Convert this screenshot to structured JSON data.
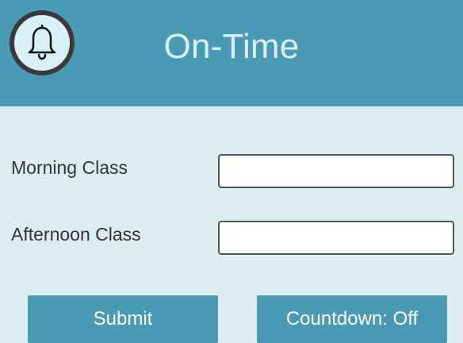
{
  "header": {
    "title": "On-Time",
    "logo_icon": "bell-icon"
  },
  "form": {
    "morning": {
      "label": "Morning Class",
      "value": "",
      "placeholder": ""
    },
    "afternoon": {
      "label": "Afternoon Class",
      "value": "",
      "placeholder": ""
    }
  },
  "buttons": {
    "submit_label": "Submit",
    "countdown_label": "Countdown: Off"
  },
  "colors": {
    "accent": "#4a9ab4",
    "background": "#dbeff3",
    "title_text": "#d8f1f8",
    "label_text": "#333333"
  }
}
